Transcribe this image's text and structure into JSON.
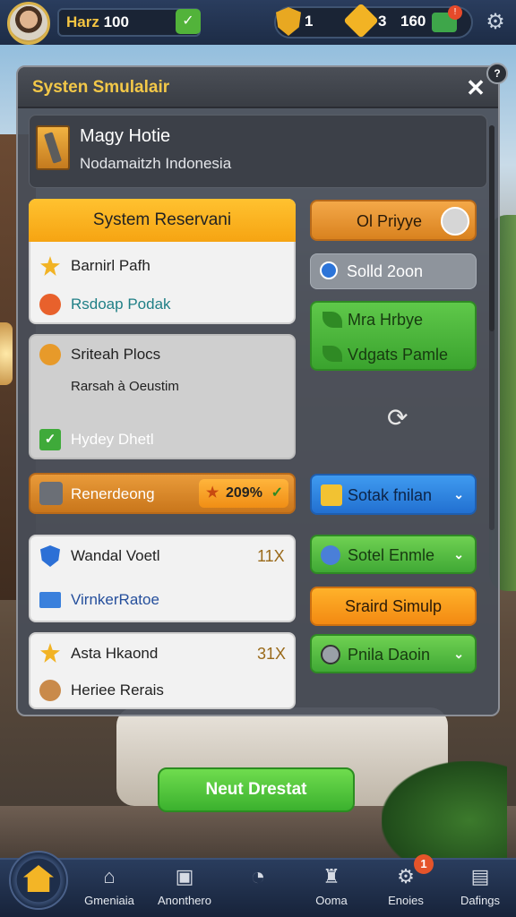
{
  "hud": {
    "player_name_prefix": "Harz",
    "player_level": "100",
    "resource_1": "1",
    "resource_2": "3",
    "resource_3": "160"
  },
  "panel": {
    "title": "Systen Smulalair",
    "hotel": {
      "name": "Magy Hotie",
      "location": "Nodamaitzh Indonesia"
    },
    "left": {
      "card_1": {
        "header": "System Reservani",
        "rows": [
          "Barnirl Pafh",
          "Rsdoap Podak"
        ]
      },
      "card_2": {
        "rows": [
          "Sriteah Plocs",
          "Rarsah à Oeustim",
          "Hydey Dhetl"
        ]
      },
      "rendering": {
        "label": "Renerdeong",
        "badge": "209%"
      },
      "card_3": {
        "rows": [
          "Wandal Voetl",
          "VirnkerRatoe"
        ],
        "count": "11X"
      },
      "card_4": {
        "rows": [
          "Asta Hkaond",
          "Heriee Rerais"
        ],
        "count": "31X"
      }
    },
    "right": {
      "btn_1": "Ol Priyye",
      "btn_2": "Solld 2oon",
      "btn_3a": "Mra Hrbye",
      "btn_3b": "Vdgats Pamle",
      "btn_4": "Sotak fnilan",
      "btn_5": "Sotel Enmle",
      "btn_6": "Sraird Simulp",
      "btn_7": "Pnila Daoin"
    },
    "next_button": "Neut Drestat",
    "help_badge": "?"
  },
  "nav": {
    "items": [
      {
        "label": "Gmeniaia"
      },
      {
        "label": "Anonthero"
      },
      {
        "label": ""
      },
      {
        "label": "Ooma"
      },
      {
        "label": "Enoies"
      },
      {
        "label": "Dafings"
      }
    ],
    "settings_badge": "1"
  }
}
